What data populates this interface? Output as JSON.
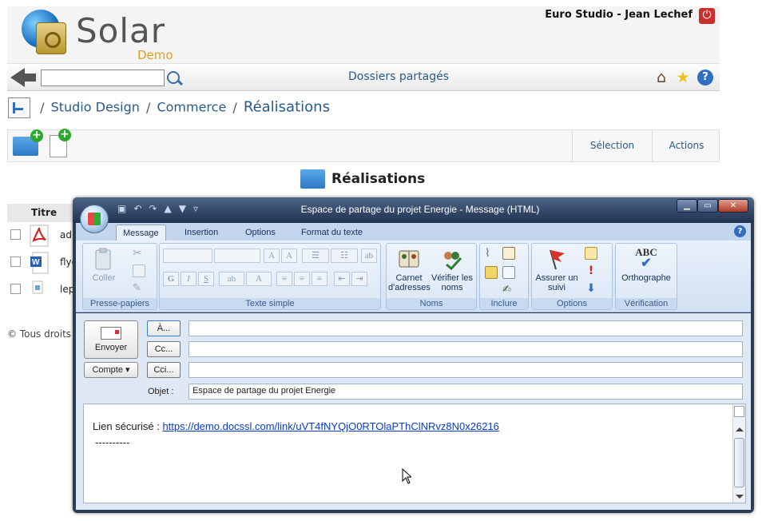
{
  "app": {
    "logo_text": "Solar",
    "logo_subtext": "Demo",
    "user": "Euro Studio - Jean Lechef",
    "search_placeholder": "",
    "toolbar_title": "Dossiers partagés",
    "breadcrumb": [
      "Studio Design",
      "Commerce",
      "Réalisations"
    ],
    "actionbar": {
      "selection_label": "Sélection",
      "actions_label": "Actions"
    },
    "folder_heading": "Réalisations",
    "table": {
      "column_title": "Titre",
      "rows": [
        {
          "name": "ad",
          "icon": "pdf-file-icon"
        },
        {
          "name": "flye",
          "icon": "word-file-icon"
        },
        {
          "name": "lep",
          "icon": "generic-file-icon"
        }
      ]
    },
    "footer": "© Tous droits"
  },
  "outlook": {
    "window_title": "Espace de partage du projet Energie - Message (HTML)",
    "tabs": [
      "Message",
      "Insertion",
      "Options",
      "Format du texte"
    ],
    "active_tab": "Message",
    "groups": {
      "clipboard": {
        "label": "Presse-papiers",
        "paste": "Coller"
      },
      "basic_text": {
        "label": "Texte simple"
      },
      "names": {
        "label": "Noms",
        "address_book": "Carnet d'adresses",
        "check_names": "Vérifier les noms"
      },
      "include": {
        "label": "Inclure"
      },
      "options": {
        "label": "Options",
        "follow_up": "Assurer un suivi"
      },
      "proofing": {
        "label": "Vérification",
        "spelling": "Orthographe",
        "spelling_icon_text": "ABC"
      }
    },
    "compose": {
      "send": "Envoyer",
      "account": "Compte",
      "to": "À...",
      "cc": "Cc...",
      "bcc": "Cci...",
      "to_value": "",
      "cc_value": "",
      "bcc_value": "",
      "subject_label": "Objet :",
      "subject_value": "Espace de partage du projet Energie",
      "body_prefix": "Lien sécurisé : ",
      "body_link": "https://demo.docssl.com/link/uVT4fNYQjO0RTOlaPThClNRvz8N0x26216",
      "body_separator": "----------"
    }
  },
  "colors": {
    "link": "#0b3cc2",
    "breadcrumb": "#2a5a88",
    "ribbon": "#dbe7f6",
    "title_bar": "#2b3c54"
  }
}
